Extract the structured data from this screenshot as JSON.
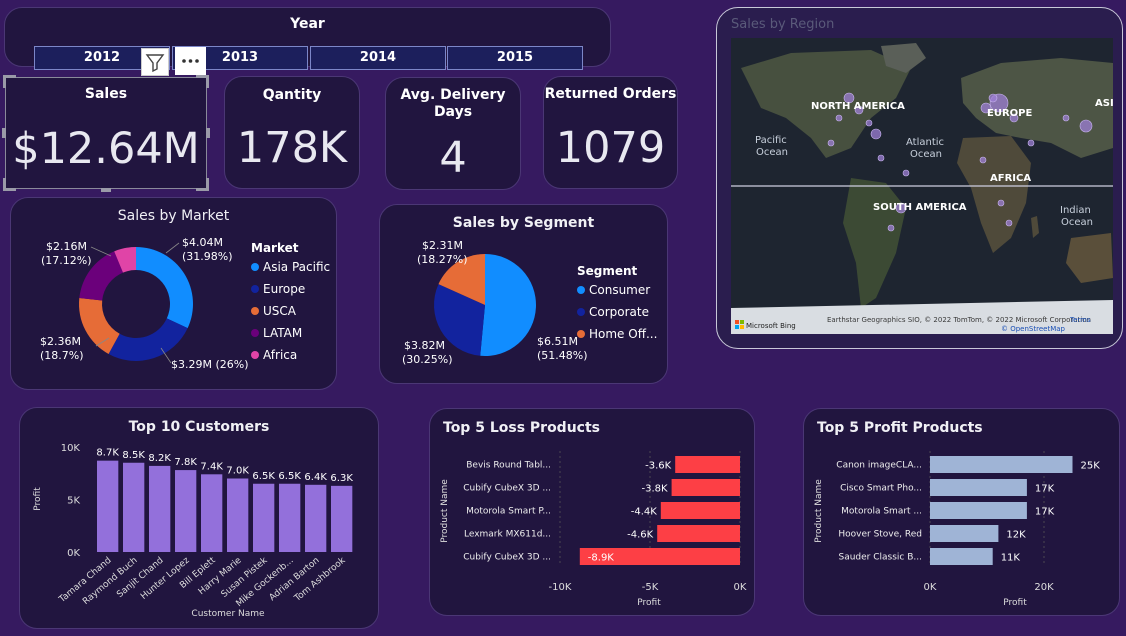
{
  "year_slicer": {
    "title": "Year",
    "years": [
      "2012",
      "2013",
      "2014",
      "2015"
    ]
  },
  "kpis": {
    "sales": {
      "title": "Sales",
      "value": "$12.64M"
    },
    "quantity": {
      "title": "Qantity",
      "value": "178K"
    },
    "delivery": {
      "title_line1": "Avg. Delivery",
      "title_line2": "Days",
      "value": "4"
    },
    "returned": {
      "title": "Returned Orders",
      "value": "1079"
    }
  },
  "map": {
    "title": "Sales by Region",
    "labels": [
      "NORTH AMERICA",
      "Pacific",
      "Ocean",
      "Atlantic",
      "Ocean",
      "EUROPE",
      "ASIA",
      "AFRICA",
      "SOUTH AMERICA",
      "Indian",
      "Ocean"
    ],
    "attribution": "Earthstar Geographics SIO, © 2022 TomTom, © 2022 Microsoft Corporation",
    "terms": "Terms",
    "osm": "© OpenStreetMap",
    "bing": "Microsoft Bing"
  },
  "colors": {
    "asia_pacific": "#118dff",
    "europe": "#12239e",
    "usca": "#e66c37",
    "latam": "#6b007b",
    "africa": "#e044a7",
    "bar_purple": "#9370db",
    "loss_red": "#fd3f45",
    "profit_blue": "#9fb4d6"
  },
  "market_chart": {
    "title": "Sales by Market",
    "legend_title": "Market"
  },
  "segment_chart": {
    "title": "Sales by Segment",
    "legend_title": "Segment"
  },
  "customers_chart": {
    "title": "Top 10 Customers"
  },
  "loss_chart": {
    "title": "Top 5 Loss Products"
  },
  "profit_chart": {
    "title": "Top 5 Profit Products"
  },
  "chart_data": [
    {
      "type": "pie",
      "title": "Sales by Market",
      "legend_title": "Market",
      "categories": [
        "Asia Pacific",
        "Europe",
        "USCA",
        "LATAM",
        "Africa"
      ],
      "values": [
        4.04,
        3.29,
        2.36,
        2.16,
        0.79
      ],
      "labels": [
        {
          "value": "$4.04M",
          "pct": "(31.98%)"
        },
        {
          "value": "$3.29M (26%)",
          "pct": ""
        },
        {
          "value": "$2.36M",
          "pct": "(18.7%)"
        },
        {
          "value": "$2.16M",
          "pct": "(17.12%)"
        }
      ]
    },
    {
      "type": "pie",
      "title": "Sales by Segment",
      "legend_title": "Segment",
      "categories": [
        "Consumer",
        "Corporate",
        "Home Off..."
      ],
      "values": [
        6.51,
        3.82,
        2.31
      ],
      "labels": [
        {
          "value": "$6.51M",
          "pct": "(51.48%)"
        },
        {
          "value": "$3.82M",
          "pct": "(30.25%)"
        },
        {
          "value": "$2.31M",
          "pct": "(18.27%)"
        }
      ]
    },
    {
      "type": "bar",
      "title": "Top 10 Customers",
      "xlabel": "Customer Name",
      "ylabel": "Profit",
      "categories": [
        "Tamara Chand",
        "Raymond Buch",
        "Sanjit Chand",
        "Hunter Lopez",
        "Bill Eplett",
        "Harry Marie",
        "Susan Pistek",
        "Mike Gockenb...",
        "Adrian Barton",
        "Tom Ashbrook"
      ],
      "values": [
        8700,
        8500,
        8200,
        7800,
        7400,
        7000,
        6500,
        6500,
        6400,
        6300
      ],
      "data_labels": [
        "8.7K",
        "8.5K",
        "8.2K",
        "7.8K",
        "7.4K",
        "7.0K",
        "6.5K",
        "6.5K",
        "6.4K",
        "6.3K"
      ],
      "yticks": [
        "0K",
        "5K",
        "10K"
      ],
      "ylim": [
        0,
        10000
      ]
    },
    {
      "type": "bar",
      "orientation": "horizontal",
      "title": "Top 5 Loss Products",
      "xlabel": "Profit",
      "ylabel": "Product Name",
      "categories": [
        "Bevis Round Tabl...",
        "Cubify CubeX 3D ...",
        "Motorola Smart P...",
        "Lexmark MX611d...",
        "Cubify CubeX 3D ..."
      ],
      "values": [
        -3600,
        -3800,
        -4400,
        -4600,
        -8900
      ],
      "data_labels": [
        "-3.6K",
        "-3.8K",
        "-4.4K",
        "-4.6K",
        "-8.9K"
      ],
      "xticks": [
        "-10K",
        "-5K",
        "0K"
      ],
      "xlim": [
        -10000,
        0
      ]
    },
    {
      "type": "bar",
      "orientation": "horizontal",
      "title": "Top 5 Profit Products",
      "xlabel": "Profit",
      "ylabel": "Product Name",
      "categories": [
        "Canon imageCLA...",
        "Cisco Smart Pho...",
        "Motorola Smart ...",
        "Hoover Stove, Red",
        "Sauder Classic B..."
      ],
      "values": [
        25000,
        17000,
        17000,
        12000,
        11000
      ],
      "data_labels": [
        "25K",
        "17K",
        "17K",
        "12K",
        "11K"
      ],
      "xticks": [
        "0K",
        "20K"
      ],
      "xlim": [
        0,
        30000
      ]
    }
  ]
}
